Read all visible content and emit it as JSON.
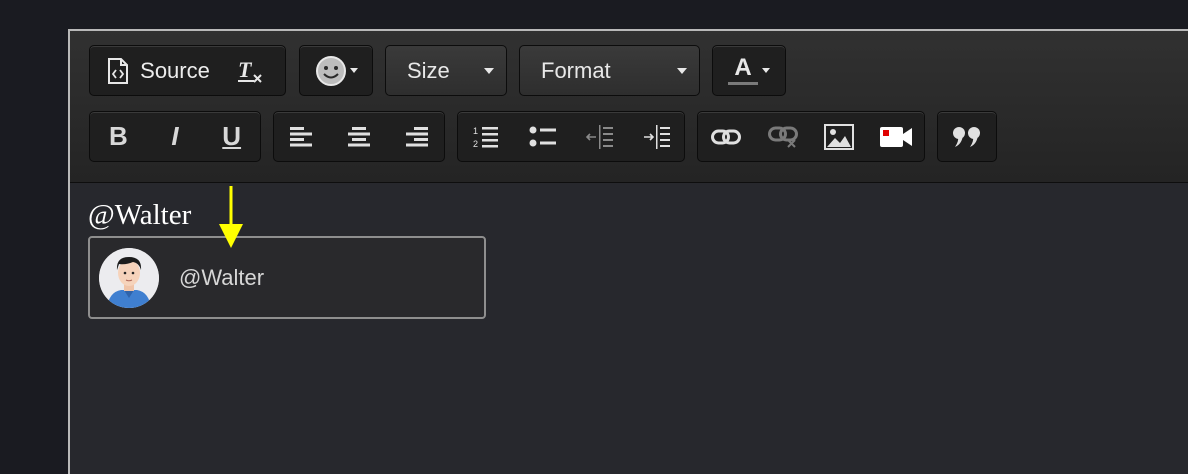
{
  "toolbar": {
    "source_label": "Source",
    "size_label": "Size",
    "format_label": "Format",
    "font_color_letter": "A",
    "row1_icons": [
      "source-icon",
      "remove-format-icon",
      "smiley-icon",
      "font-color-icon"
    ],
    "row2_icons": [
      "bold-icon",
      "italic-icon",
      "underline-icon",
      "align-left-icon",
      "align-center-icon",
      "align-right-icon",
      "numbered-list-icon",
      "bulleted-list-icon",
      "decrease-indent-icon",
      "increase-indent-icon",
      "link-icon",
      "unlink-icon",
      "image-icon",
      "video-icon",
      "blockquote-icon"
    ],
    "bold_letter": "B",
    "italic_letter": "I",
    "underline_letter": "U"
  },
  "content": {
    "mention_text": "@Walter"
  },
  "suggestion": {
    "name": "@Walter",
    "avatar_icon": "user-avatar"
  },
  "colors": {
    "background": "#1a1b21",
    "editor_bg": "#27282d",
    "arrow": "#ffff00",
    "video_red": "#e00000"
  }
}
